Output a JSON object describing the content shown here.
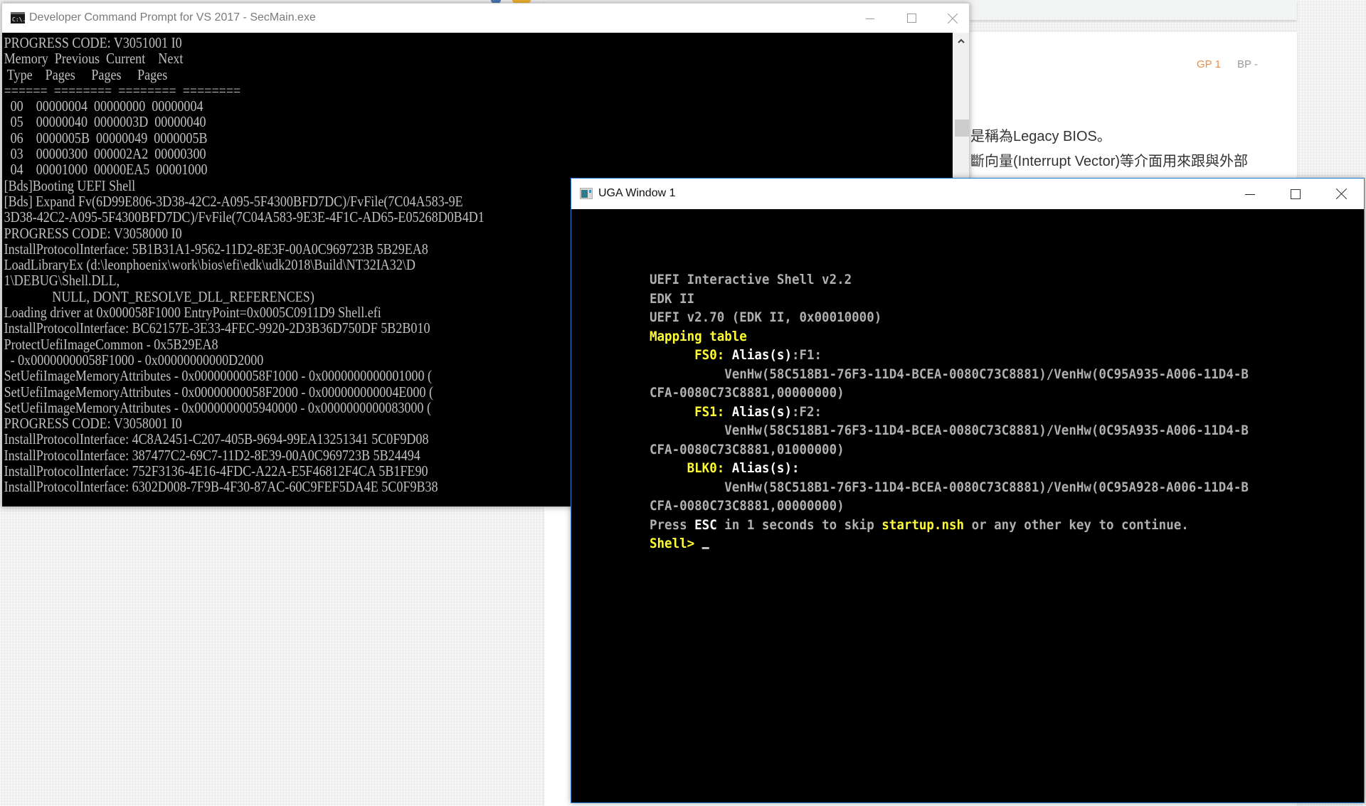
{
  "background_page": {
    "score_gp": "GP 1",
    "score_bp": "BP -",
    "text_line_1": "是稱為Legacy BIOS。",
    "text_line_2": "斷向量(Interrupt Vector)等介面用來跟與外部"
  },
  "console_window": {
    "title": "Developer Command Prompt for VS 2017 - SecMain.exe",
    "icon": "cmd-icon",
    "controls": {
      "minimize": "minimize-icon",
      "maximize": "maximize-icon",
      "close": "close-icon"
    },
    "lines": [
      "PROGRESS CODE: V3051001 I0",
      "Memory  Previous  Current    Next",
      " Type    Pages     Pages     Pages",
      "======  ========  ========  ========",
      "  00    00000004  00000000  00000004",
      "  05    00000040  0000003D  00000040",
      "  06    0000005B  00000049  0000005B",
      "  03    00000300  000002A2  00000300",
      "  04    00001000  00000EA5  00001000",
      "[Bds]Booting UEFI Shell",
      "[Bds] Expand Fv(6D99E806-3D38-42C2-A095-5F4300BFD7DC)/FvFile(7C04A583-9E",
      "3D38-42C2-A095-5F4300BFD7DC)/FvFile(7C04A583-9E3E-4F1C-AD65-E05268D0B4D1",
      "PROGRESS CODE: V3058000 I0",
      "InstallProtocolInterface: 5B1B31A1-9562-11D2-8E3F-00A0C969723B 5B29EA8",
      "LoadLibraryEx (d:\\leonphoenix\\work\\bios\\efi\\edk\\udk2018\\Build\\NT32IA32\\D",
      "1\\DEBUG\\Shell.DLL,",
      "               NULL, DONT_RESOLVE_DLL_REFERENCES)",
      "Loading driver at 0x000058F1000 EntryPoint=0x0005C0911D9 Shell.efi",
      "InstallProtocolInterface: BC62157E-3E33-4FEC-9920-2D3B36D750DF 5B2B010",
      "ProtectUefiImageCommon - 0x5B29EA8",
      "  - 0x00000000058F1000 - 0x00000000000D2000",
      "SetUefiImageMemoryAttributes - 0x00000000058F1000 - 0x0000000000001000 (",
      "SetUefiImageMemoryAttributes - 0x00000000058F2000 - 0x000000000004E000 (",
      "SetUefiImageMemoryAttributes - 0x0000000005940000 - 0x0000000000083000 (",
      "PROGRESS CODE: V3058001 I0",
      "InstallProtocolInterface: 4C8A2451-C207-405B-9694-99EA13251341 5C0F9D08",
      "InstallProtocolInterface: 387477C2-69C7-11D2-8E39-00A0C969723B 5B24494",
      "InstallProtocolInterface: 752F3136-4E16-4FDC-A22A-E5F46812F4CA 5B1FE90",
      "InstallProtocolInterface: 6302D008-7F9B-4F30-87AC-60C9FEF5DA4E 5C0F9B38"
    ],
    "scrollbar": {
      "up_arrow": "chevron-up-icon"
    }
  },
  "uga_window": {
    "title": "UGA Window 1",
    "icon": "app-window-icon",
    "controls": {
      "minimize": "minimize-icon",
      "maximize": "maximize-icon",
      "close": "close-icon"
    },
    "colors": {
      "normal": "#b0b0b0",
      "highlight": "#ffff33",
      "bright": "#ffffff"
    },
    "shell": {
      "banner_1": "UEFI Interactive Shell v2.2",
      "banner_2": "EDK II",
      "banner_3": "UEFI v2.70 (EDK II, 0x00010000)",
      "mapping_title": "Mapping table",
      "mappings": [
        {
          "indent": "      ",
          "name": "FS0",
          "alias_label": " Alias(s)",
          "alias_value": ":F1:",
          "path_1": "          VenHw(58C518B1-76F3-11D4-BCEA-0080C73C8881)/VenHw(0C95A935-A006-11D4-B",
          "path_2": "CFA-0080C73C8881,00000000)"
        },
        {
          "indent": "      ",
          "name": "FS1",
          "alias_label": " Alias(s)",
          "alias_value": ":F2:",
          "path_1": "          VenHw(58C518B1-76F3-11D4-BCEA-0080C73C8881)/VenHw(0C95A935-A006-11D4-B",
          "path_2": "CFA-0080C73C8881,01000000)"
        },
        {
          "indent": "     ",
          "name": "BLK0",
          "alias_label": " Alias(s)",
          "alias_value": ":",
          "path_1": "          VenHw(58C518B1-76F3-11D4-BCEA-0080C73C8881)/VenHw(0C95A928-A006-11D4-B",
          "path_2": "CFA-0080C73C8881,00000000)"
        }
      ],
      "press_1": "Press ",
      "press_key": "ESC",
      "press_2": " in 1 seconds to skip ",
      "press_file": "startup.nsh",
      "press_3": " or any other key to continue.",
      "prompt": "Shell> "
    }
  }
}
